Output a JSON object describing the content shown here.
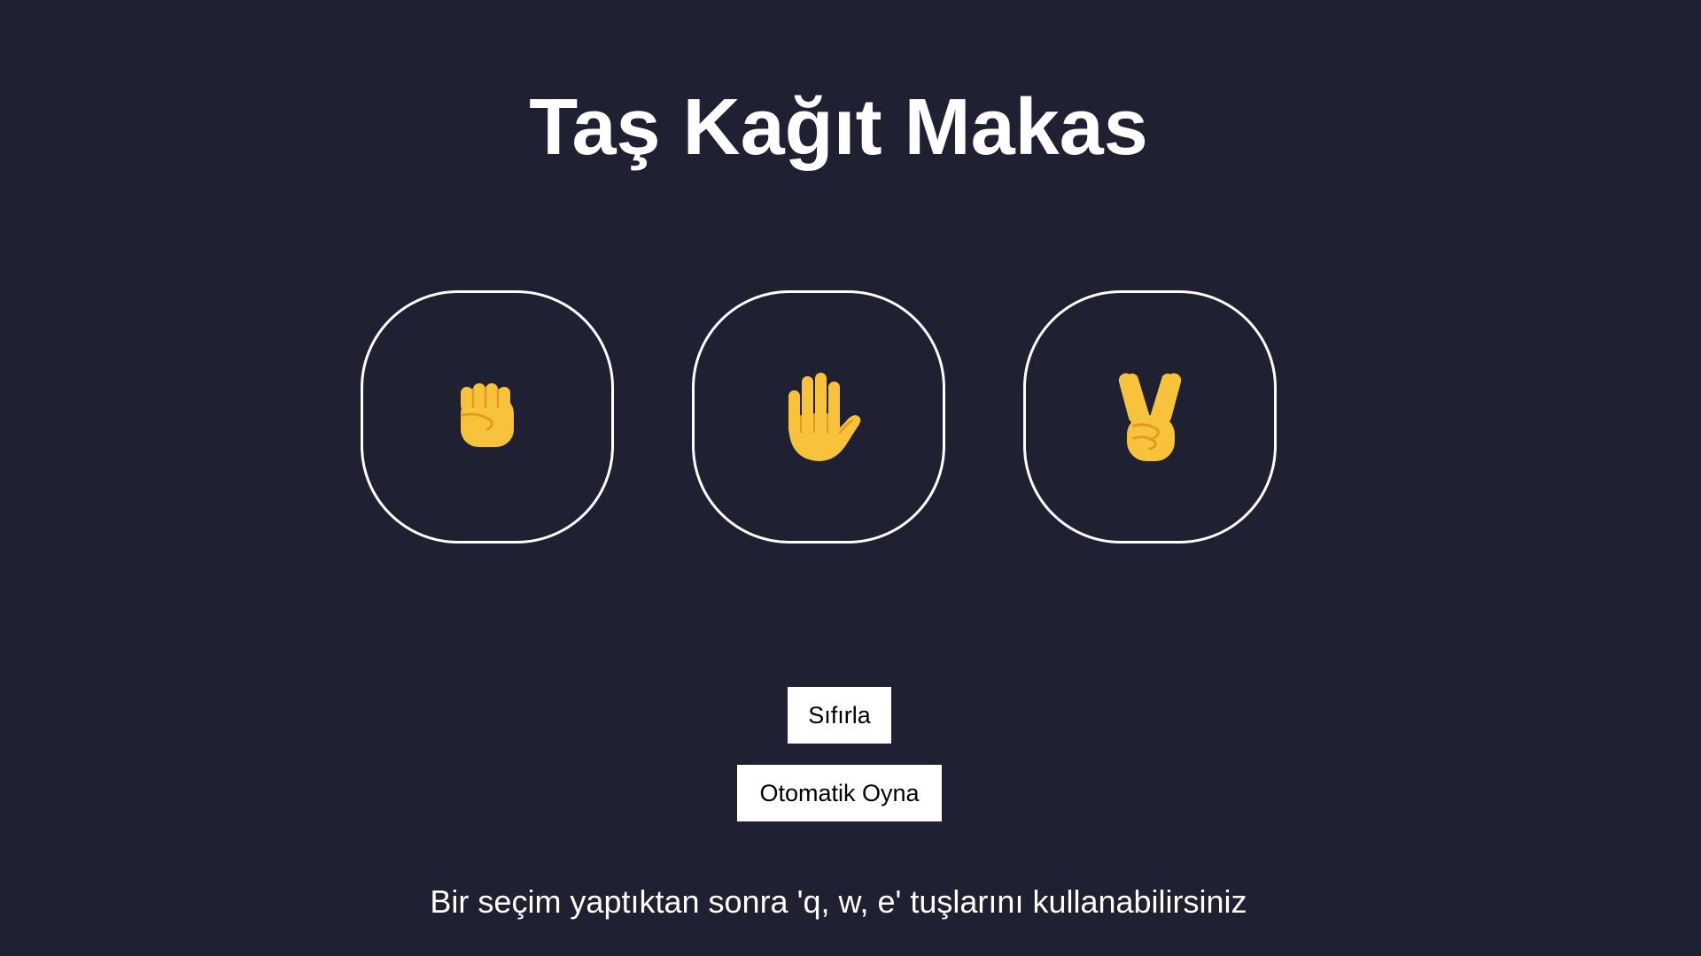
{
  "page": {
    "title": "Taş Kağıt Makas",
    "hint": "Bir seçim yaptıktan sonra 'q, w, e' tuşlarını kullanabilirsiniz"
  },
  "colors": {
    "background": "#1f2031",
    "text": "#ffffff",
    "choice_border": "#ffffff",
    "emoji_skin": "#f8c33b",
    "emoji_shade": "#e39a22",
    "button_bg": "#ffffff",
    "button_text": "#000000"
  },
  "choices": [
    {
      "name": "rock",
      "icon": "raised-fist-icon",
      "emoji": "✊"
    },
    {
      "name": "paper",
      "icon": "raised-hand-icon",
      "emoji": "🖐"
    },
    {
      "name": "scissors",
      "icon": "victory-hand-icon",
      "emoji": "✌"
    }
  ],
  "buttons": {
    "reset_label": "Sıfırla",
    "autoplay_label": "Otomatik Oyna"
  }
}
